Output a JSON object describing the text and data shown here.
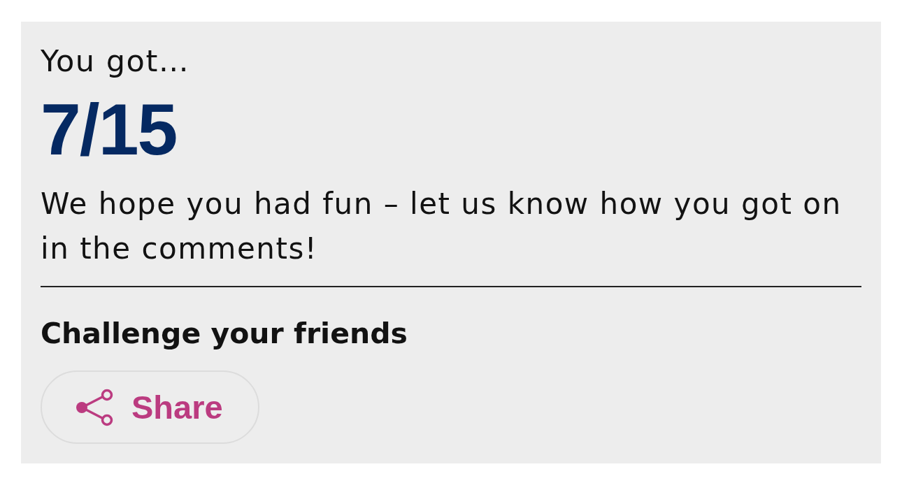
{
  "result": {
    "intro": "You got…",
    "score": "7/15",
    "message": "We hope you had fun – let us know how you got on in the comments!"
  },
  "share": {
    "heading": "Challenge your friends",
    "button": "Share"
  }
}
